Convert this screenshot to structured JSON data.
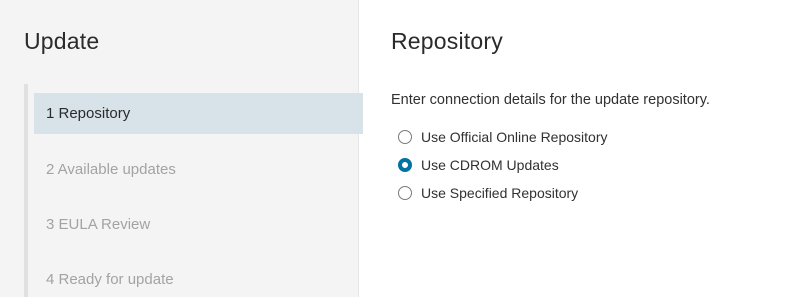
{
  "sidebar": {
    "title": "Update",
    "steps": [
      {
        "label": "1 Repository",
        "active": true
      },
      {
        "label": "2 Available updates",
        "active": false
      },
      {
        "label": "3 EULA Review",
        "active": false
      },
      {
        "label": "4 Ready for update",
        "active": false
      }
    ]
  },
  "main": {
    "title": "Repository",
    "instruction": "Enter connection details for the update repository.",
    "options": [
      {
        "label": "Use Official Online Repository",
        "checked": false
      },
      {
        "label": "Use CDROM Updates",
        "checked": true
      },
      {
        "label": "Use Specified Repository",
        "checked": false
      }
    ]
  },
  "colors": {
    "active_step_bg": "#d8e3e9",
    "radio_accent": "#0072a3",
    "sidebar_bg": "#f4f4f4"
  }
}
